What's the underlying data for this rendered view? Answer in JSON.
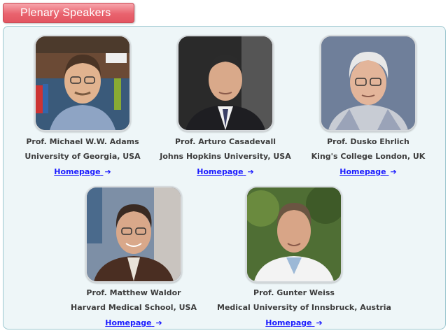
{
  "header": {
    "title": "Plenary Speakers"
  },
  "speakers": [
    {
      "name": "Prof. Michael W.W. Adams",
      "affiliation": "University of Georgia, USA",
      "link_label": "Homepage",
      "link_arrow": "➔",
      "photo": "photo-of-michael-adams"
    },
    {
      "name": "Prof. Arturo Casadevall",
      "affiliation": "Johns Hopkins University, USA",
      "link_label": "Homepage",
      "link_arrow": "➔",
      "photo": "photo-of-arturo-casadevall"
    },
    {
      "name": "Prof. Dusko Ehrlich",
      "affiliation": "King's College London, UK",
      "link_label": "Homepage",
      "link_arrow": "➔",
      "photo": "photo-of-dusko-ehrlich"
    },
    {
      "name": "Prof. Matthew Waldor",
      "affiliation": "Harvard Medical School, USA",
      "link_label": "Homepage",
      "link_arrow": "➔",
      "photo": "photo-of-matthew-waldor"
    },
    {
      "name": "Prof. Gunter Weiss",
      "affiliation": "Medical University of Innsbruck, Austria",
      "link_label": "Homepage",
      "link_arrow": "➔",
      "photo": "photo-of-gunter-weiss"
    }
  ],
  "colors": {
    "header_bg": "#e9636e",
    "panel_bg": "#eef6f8",
    "panel_border": "#9cc7cf",
    "link": "#1a1aff",
    "text": "#3c3c3c"
  }
}
